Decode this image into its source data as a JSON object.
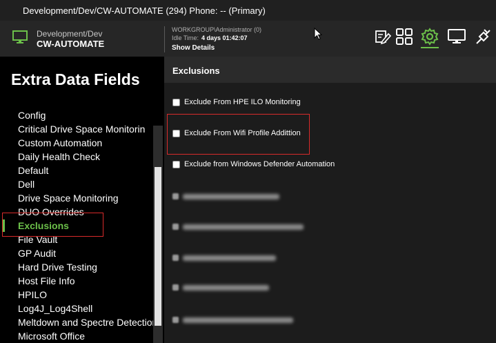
{
  "window": {
    "title": "Development/Dev/CW-AUTOMATE (294) Phone: -- (Primary)"
  },
  "header": {
    "breadcrumb": "Development/Dev",
    "machine_name": "CW-AUTOMATE",
    "user": "WORKGROUP\\Administrator (0)",
    "idle_label": "Idle Time:",
    "idle_value": "4 days 01:42:07",
    "show_details": "Show Details",
    "icons": [
      "edit-icon",
      "grid-icon",
      "gear-icon",
      "monitor-icon",
      "plug-icon"
    ],
    "accent": "#6cc04a"
  },
  "left_panel": {
    "title": "Extra Data Fields",
    "items": [
      "Config",
      "Critical Drive Space Monitorin",
      "Custom Automation",
      "Daily Health Check",
      "Default",
      "Dell",
      "Drive Space Monitoring",
      "DUO Overrides",
      "Exclusions",
      "File Vault",
      "GP Audit",
      "Hard Drive Testing",
      "Host File Info",
      "HPILO",
      "Log4J_Log4Shell",
      "Meltdown and Spectre Detection",
      "Microsoft Office"
    ],
    "selected": "Exclusions"
  },
  "right_panel": {
    "title": "Exclusions",
    "checkboxes": [
      {
        "label": "Exclude From HPE ILO Monitoring",
        "checked": false
      },
      {
        "label": "Exclude From Wifi Profile Addittion",
        "checked": false
      },
      {
        "label": "Exclude from Windows Defender Automation",
        "checked": false
      }
    ]
  },
  "highlight_color": "#d92b2b"
}
